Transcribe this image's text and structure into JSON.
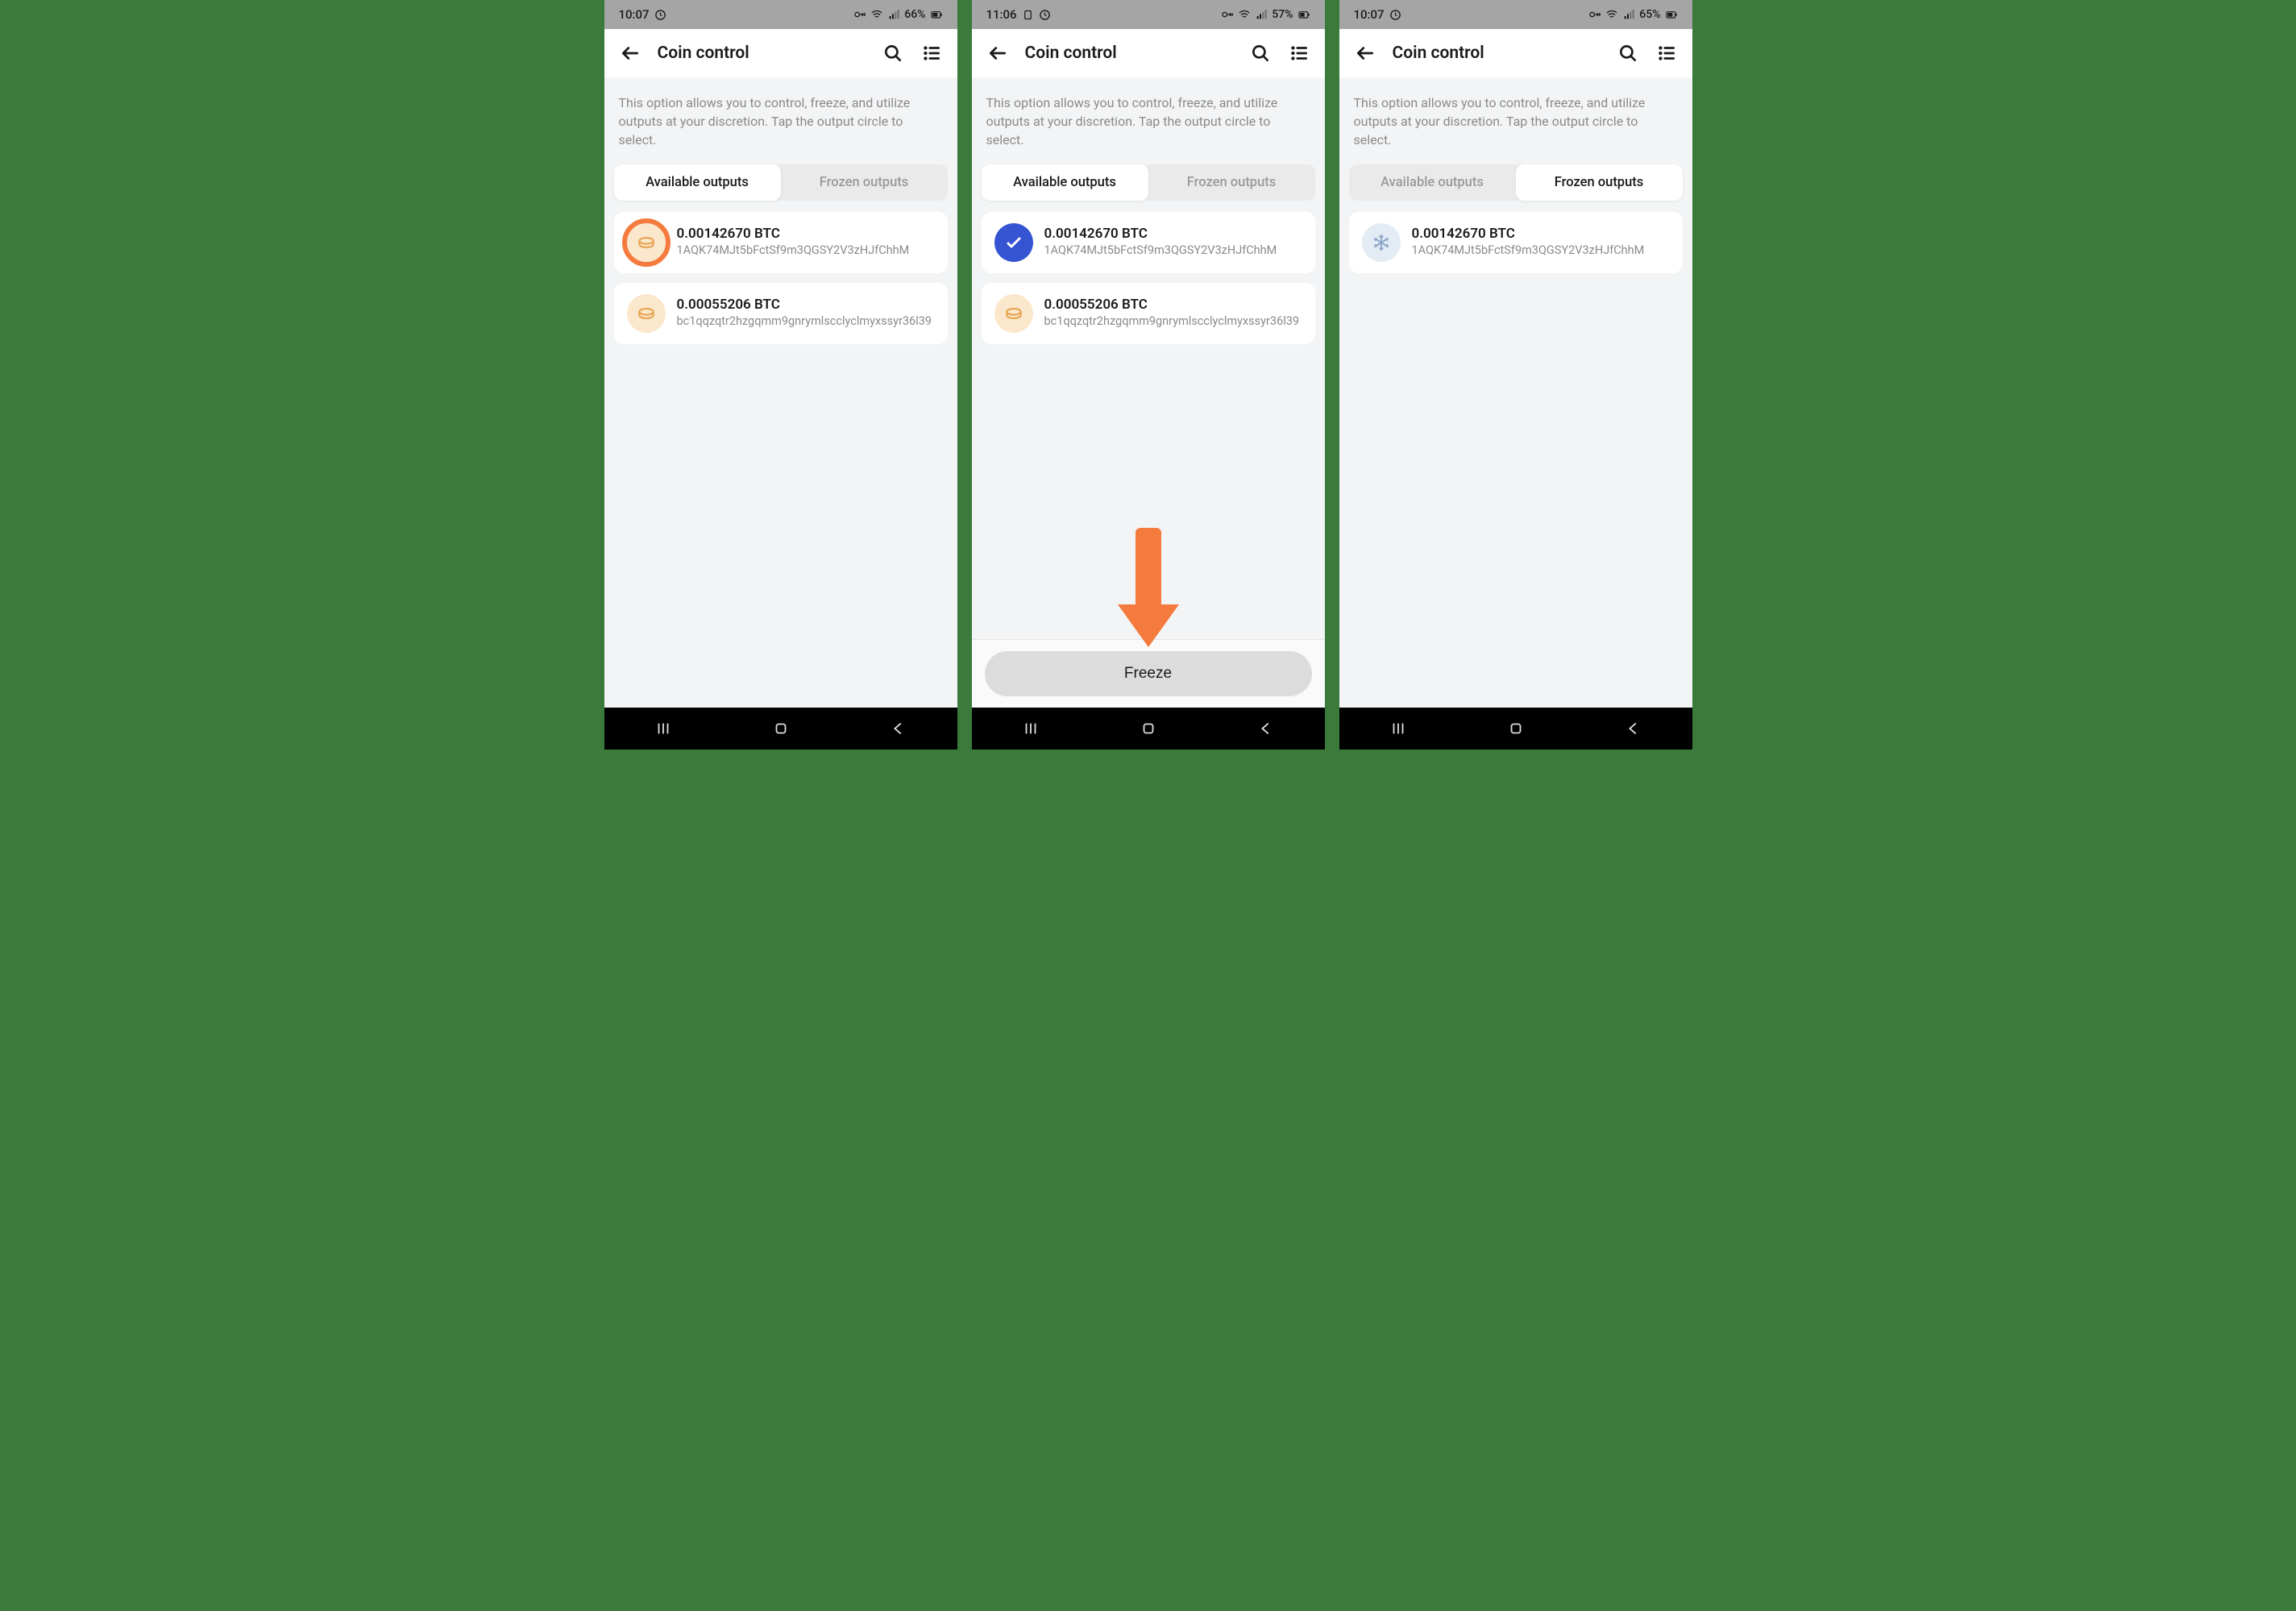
{
  "screens": [
    {
      "status": {
        "time": "10:07",
        "battery": "66%"
      },
      "title": "Coin control",
      "info": "This option allows you to control, freeze, and utilize outputs at your discretion. Tap the output circle to select.",
      "tabs": {
        "available": "Available outputs",
        "frozen": "Frozen outputs",
        "active": "available",
        "underline": false
      },
      "outputs": [
        {
          "amount": "0.00142670 BTC",
          "addr": "1AQK74MJt5bFctSf9m3QGSY2V3zHJfChhM",
          "circle": "default",
          "highlight": true
        },
        {
          "amount": "0.00055206 BTC",
          "addr": "bc1qqzqtr2hzgqmm9gnrymlscclyclmyxssyr36l39",
          "circle": "default",
          "highlight": false
        }
      ],
      "freezeButton": null,
      "arrow": false
    },
    {
      "status": {
        "time": "11:06",
        "battery": "57%"
      },
      "title": "Coin control",
      "info": "This option allows you to control, freeze, and utilize outputs at your discretion. Tap the output circle to select.",
      "tabs": {
        "available": "Available outputs",
        "frozen": "Frozen outputs",
        "active": "available",
        "underline": false
      },
      "outputs": [
        {
          "amount": "0.00142670 BTC",
          "addr": "1AQK74MJt5bFctSf9m3QGSY2V3zHJfChhM",
          "circle": "selected",
          "highlight": false
        },
        {
          "amount": "0.00055206 BTC",
          "addr": "bc1qqzqtr2hzgqmm9gnrymlscclyclmyxssyr36l39",
          "circle": "default",
          "highlight": false
        }
      ],
      "freezeButton": "Freeze",
      "arrow": true
    },
    {
      "status": {
        "time": "10:07",
        "battery": "65%"
      },
      "title": "Coin control",
      "info": "This option allows you to control, freeze, and utilize outputs at your discretion. Tap the output circle to select.",
      "tabs": {
        "available": "Available outputs",
        "frozen": "Frozen outputs",
        "active": "frozen",
        "underline": true
      },
      "outputs": [
        {
          "amount": "0.00142670 BTC",
          "addr": "1AQK74MJt5bFctSf9m3QGSY2V3zHJfChhM",
          "circle": "frozen",
          "highlight": false
        }
      ],
      "freezeButton": null,
      "arrow": false
    }
  ]
}
